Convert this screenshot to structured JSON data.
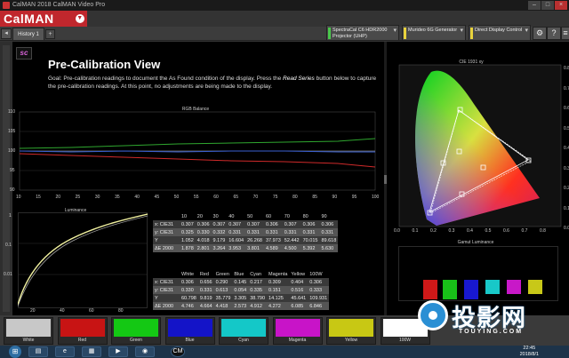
{
  "window": {
    "title": "CalMAN 2018 CalMAN Video Pro",
    "min": "–",
    "max": "□",
    "close": "×"
  },
  "app_logo": "CalMAN",
  "toolbar": {
    "tab_label": "History 1",
    "add_tab": "+",
    "back": "◂",
    "devices": [
      {
        "line1": "SpectraCal C6 HDR2000",
        "line2": "Projector (UHP)",
        "color": "#49c84b"
      },
      {
        "line1": "Murideo 6G Generator",
        "line2": "",
        "color": "#e8d23c"
      },
      {
        "line1": "Direct Display Control",
        "line2": "",
        "color": "#e8d23c"
      }
    ],
    "icons": [
      "gear-icon",
      "help-icon",
      "menu-icon"
    ]
  },
  "page": {
    "title": "Pre-Calibration View",
    "goal_prefix": "Goal: Pre-calibration readings to document the As Found condition of the display. Press the ",
    "goal_emph": "Read Series",
    "goal_suffix": " button below to capture the pre-calibration readings. At this point, no adjustments are being made to the display."
  },
  "rgb_balance": {
    "title": "RGB Balance",
    "y_ticks": [
      "110",
      "105",
      "100",
      "95",
      "90"
    ],
    "x_ticks": [
      "10",
      "15",
      "20",
      "25",
      "30",
      "35",
      "40",
      "45",
      "50",
      "55",
      "60",
      "65",
      "70",
      "75",
      "80",
      "85",
      "90",
      "95",
      "100"
    ]
  },
  "luminance": {
    "title": "Luminance",
    "y_ticks": [
      "1",
      "0.1",
      "0.01"
    ],
    "x_ticks": [
      "20",
      "40",
      "60",
      "80"
    ]
  },
  "table1": {
    "headers": [
      "",
      "10",
      "20",
      "30",
      "40",
      "50",
      "60",
      "70",
      "80",
      "90"
    ],
    "rows": [
      [
        "x: CIE31",
        "0.307",
        "0.306",
        "0.307",
        "0.307",
        "0.307",
        "0.306",
        "0.307",
        "0.306",
        "0.306"
      ],
      [
        "y: CIE31",
        "0.325",
        "0.330",
        "0.332",
        "0.331",
        "0.331",
        "0.331",
        "0.331",
        "0.331",
        "0.331"
      ],
      [
        "Y",
        "1.052",
        "4.018",
        "9.179",
        "16.604",
        "26.268",
        "37.973",
        "52.442",
        "70.015",
        "89.618"
      ],
      [
        "ΔE 2000",
        "1.878",
        "2.801",
        "3.264",
        "3.953",
        "3.801",
        "4.589",
        "4.500",
        "5.392",
        "5.630"
      ]
    ]
  },
  "table2": {
    "headers": [
      "",
      "White",
      "Red",
      "Green",
      "Blue",
      "Cyan",
      "Magenta",
      "Yellow",
      "100W"
    ],
    "rows": [
      [
        "x: CIE31",
        "0.306",
        "0.656",
        "0.290",
        "0.145",
        "0.217",
        "0.309",
        "0.404",
        "0.306"
      ],
      [
        "y: CIE31",
        "0.330",
        "0.331",
        "0.613",
        "0.054",
        "0.335",
        "0.151",
        "0.516",
        "0.333"
      ],
      [
        "Y",
        "60.798",
        "9.819",
        "35.779",
        "3.305",
        "38.790",
        "14.125",
        "45.641",
        "109.931"
      ],
      [
        "ΔE 2000",
        "4.746",
        "4.664",
        "4.418",
        "2.573",
        "4.912",
        "4.272",
        "6.085",
        "6.846"
      ]
    ]
  },
  "cie": {
    "title": "CIE 1931 xy",
    "x_ticks": [
      "0.0",
      "0.1",
      "0.2",
      "0.3",
      "0.4",
      "0.5",
      "0.6",
      "0.7",
      "0.8"
    ],
    "y_ticks": [
      "0.8",
      "0.7",
      "0.6",
      "0.5",
      "0.4",
      "0.3",
      "0.2",
      "0.1",
      "0.0"
    ]
  },
  "gamut_luminance": {
    "title": "Gamut Luminance"
  },
  "swatches": [
    {
      "label": "White",
      "color": "#c8c8c8"
    },
    {
      "label": "Red",
      "color": "#c81414"
    },
    {
      "label": "Green",
      "color": "#14c814"
    },
    {
      "label": "Blue",
      "color": "#1414c8"
    },
    {
      "label": "Cyan",
      "color": "#14c8c8"
    },
    {
      "label": "Magenta",
      "color": "#c814c8"
    },
    {
      "label": "Yellow",
      "color": "#c8c814"
    },
    {
      "label": "100W",
      "color": "#ffffff"
    }
  ],
  "taskbar": {
    "time": "22:45",
    "date": "2018/8/1",
    "cm": "CM"
  },
  "watermark": {
    "text": "投影网",
    "sub": "TOUYING.COM"
  }
}
